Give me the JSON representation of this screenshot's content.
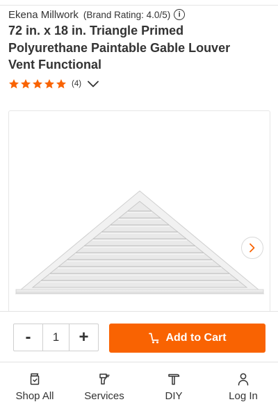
{
  "product": {
    "brand": "Ekena Millwork",
    "brand_rating": "(Brand Rating: 4.0/5)",
    "title": "72 in. x 18 in. Triangle Primed Polyurethane Paintable Gable Louver Vent Functional",
    "stars": 5,
    "review_count": "(4)"
  },
  "cart": {
    "minus_label": "-",
    "quantity": "1",
    "plus_label": "+",
    "add_label": "Add to Cart"
  },
  "bottom_nav": {
    "shop_all": "Shop All",
    "services": "Services",
    "diy": "DIY",
    "log_in": "Log In"
  },
  "colors": {
    "accent": "#f96302",
    "text": "#333333"
  }
}
